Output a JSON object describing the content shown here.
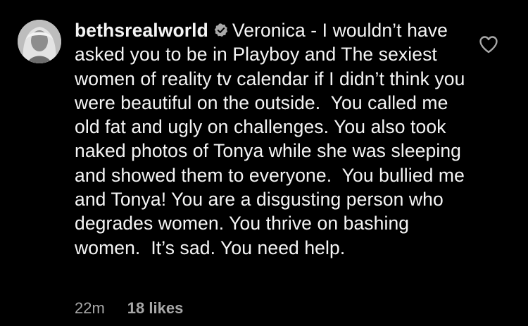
{
  "comment": {
    "username": "bethsrealworld",
    "verified_icon": "verified-badge-icon",
    "text": "Veronica - I wouldn’t have asked you to be in Playboy and The sexiest women of reality tv calendar if I didn’t think you were beautiful on the outside.  You called me old fat and ugly on challenges. You also took naked photos of Tonya while she was sleeping and showed them to everyone.  You bullied me and Tonya! You are a disgusting person who degrades women. You thrive on bashing women.  It’s sad. You need help.",
    "time": "22m",
    "likes": "18 likes",
    "like_icon": "heart-outline-icon"
  },
  "colors": {
    "background": "#000000",
    "text": "#f5f5f5",
    "secondary": "#a8a8a8"
  }
}
